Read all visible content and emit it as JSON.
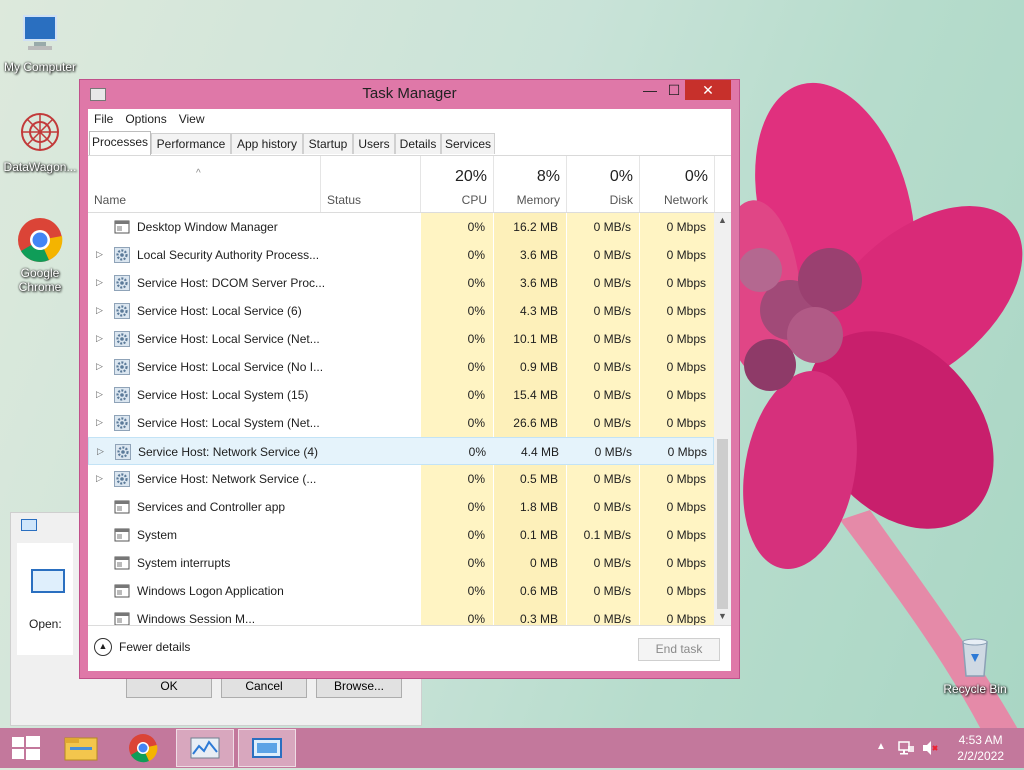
{
  "desktop_icons": [
    {
      "label": "My Computer"
    },
    {
      "label": "DataWagon..."
    },
    {
      "label": "Google Chrome"
    },
    {
      "label": "Recycle Bin"
    }
  ],
  "bg_dialog": {
    "open_label": "Open:",
    "ok": "OK",
    "cancel": "Cancel",
    "browse": "Browse..."
  },
  "taskmanager": {
    "title": "Task Manager",
    "controls": {
      "minimize": "—",
      "maximize": "☐",
      "close": "✕"
    },
    "menu": [
      "File",
      "Options",
      "View"
    ],
    "tabs": [
      "Processes",
      "Performance",
      "App history",
      "Startup",
      "Users",
      "Details",
      "Services"
    ],
    "active_tab": "Processes",
    "columns": {
      "name": "Name",
      "status": "Status",
      "cpu": {
        "pct": "20%",
        "label": "CPU"
      },
      "memory": {
        "pct": "8%",
        "label": "Memory"
      },
      "disk": {
        "pct": "0%",
        "label": "Disk"
      },
      "network": {
        "pct": "0%",
        "label": "Network"
      }
    },
    "rows": [
      {
        "name": "Desktop Window Manager",
        "expandable": false,
        "icon": "window-icon",
        "cpu": "0%",
        "memory": "16.2 MB",
        "disk": "0 MB/s",
        "network": "0 Mbps"
      },
      {
        "name": "Local Security Authority Process...",
        "expandable": true,
        "icon": "gear-icon",
        "cpu": "0%",
        "memory": "3.6 MB",
        "disk": "0 MB/s",
        "network": "0 Mbps"
      },
      {
        "name": "Service Host: DCOM Server Proc...",
        "expandable": true,
        "icon": "gear-icon",
        "cpu": "0%",
        "memory": "3.6 MB",
        "disk": "0 MB/s",
        "network": "0 Mbps"
      },
      {
        "name": "Service Host: Local Service (6)",
        "expandable": true,
        "icon": "gear-icon",
        "cpu": "0%",
        "memory": "4.3 MB",
        "disk": "0 MB/s",
        "network": "0 Mbps"
      },
      {
        "name": "Service Host: Local Service (Net...",
        "expandable": true,
        "icon": "gear-icon",
        "cpu": "0%",
        "memory": "10.1 MB",
        "disk": "0 MB/s",
        "network": "0 Mbps"
      },
      {
        "name": "Service Host: Local Service (No I...",
        "expandable": true,
        "icon": "gear-icon",
        "cpu": "0%",
        "memory": "0.9 MB",
        "disk": "0 MB/s",
        "network": "0 Mbps"
      },
      {
        "name": "Service Host: Local System (15)",
        "expandable": true,
        "icon": "gear-icon",
        "cpu": "0%",
        "memory": "15.4 MB",
        "disk": "0 MB/s",
        "network": "0 Mbps"
      },
      {
        "name": "Service Host: Local System (Net...",
        "expandable": true,
        "icon": "gear-icon",
        "cpu": "0%",
        "memory": "26.6 MB",
        "disk": "0 MB/s",
        "network": "0 Mbps"
      },
      {
        "name": "Service Host: Network Service (4)",
        "expandable": true,
        "icon": "gear-icon",
        "cpu": "0%",
        "memory": "4.4 MB",
        "disk": "0 MB/s",
        "network": "0 Mbps",
        "selected": true
      },
      {
        "name": "Service Host: Network Service (...",
        "expandable": true,
        "icon": "gear-icon",
        "cpu": "0%",
        "memory": "0.5 MB",
        "disk": "0 MB/s",
        "network": "0 Mbps"
      },
      {
        "name": "Services and Controller app",
        "expandable": false,
        "icon": "window-icon",
        "cpu": "0%",
        "memory": "1.8 MB",
        "disk": "0 MB/s",
        "network": "0 Mbps"
      },
      {
        "name": "System",
        "expandable": false,
        "icon": "window-icon",
        "cpu": "0%",
        "memory": "0.1 MB",
        "disk": "0.1 MB/s",
        "network": "0 Mbps"
      },
      {
        "name": "System interrupts",
        "expandable": false,
        "icon": "window-icon",
        "cpu": "0%",
        "memory": "0 MB",
        "disk": "0 MB/s",
        "network": "0 Mbps"
      },
      {
        "name": "Windows Logon Application",
        "expandable": false,
        "icon": "window-icon",
        "cpu": "0%",
        "memory": "0.6 MB",
        "disk": "0 MB/s",
        "network": "0 Mbps"
      },
      {
        "name": "Windows Session M...",
        "expandable": false,
        "icon": "window-icon",
        "cpu": "0%",
        "memory": "0.3 MB",
        "disk": "0 MB/s",
        "network": "0 Mbps"
      }
    ],
    "fewer_details": "Fewer details",
    "end_task": "End task"
  },
  "taskbar": {
    "items": [
      "start-icon",
      "file-explorer-icon",
      "chrome-icon",
      "task-manager-icon",
      "run-dialog-icon"
    ],
    "clock_time": "4:53 AM",
    "clock_date": "2/2/2022"
  }
}
